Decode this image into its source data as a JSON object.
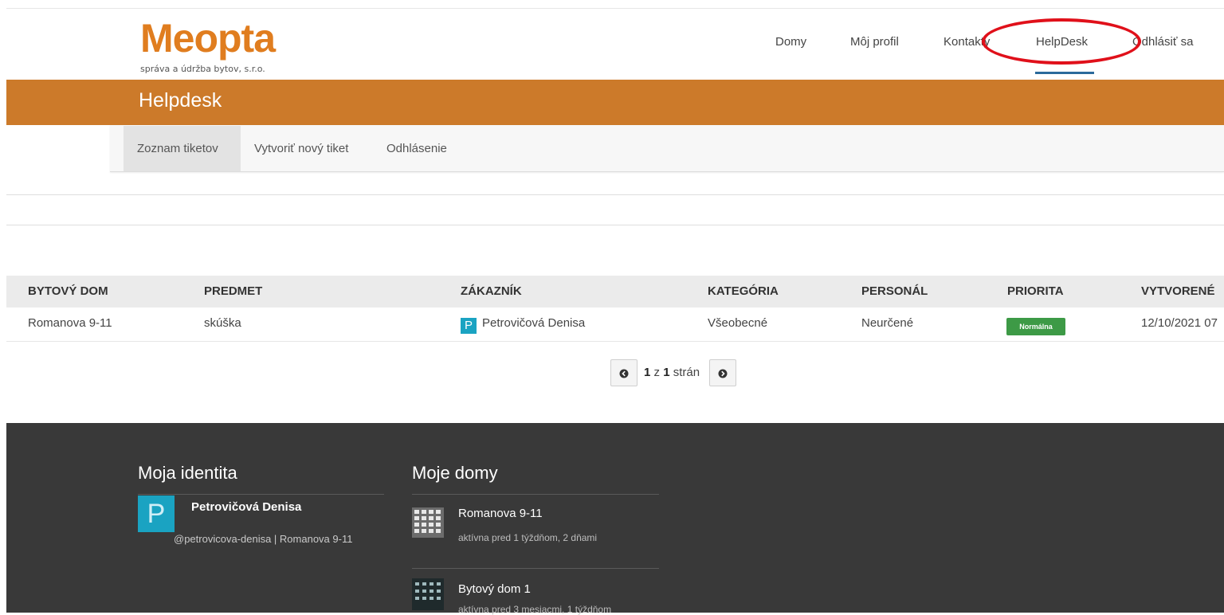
{
  "header": {
    "logo": "Meopta",
    "logo_sub": "správa a údržba bytov, s.r.o.",
    "nav": [
      "Domy",
      "Môj profil",
      "Kontakty",
      "HelpDesk",
      "Odhlásiť sa"
    ]
  },
  "page_title": "Helpdesk",
  "subnav": [
    "Zoznam tiketov",
    "Vytvoriť nový tiket",
    "Odhlásenie"
  ],
  "table": {
    "columns": [
      "BYTOVÝ DOM",
      "PREDMET",
      "ZÁKAZNÍK",
      "KATEGÓRIA",
      "PERSONÁL",
      "PRIORITA",
      "VYTVORENÉ"
    ],
    "rows": [
      {
        "house": "Romanova 9-11",
        "subject": "skúška",
        "customer_initial": "P",
        "customer": "Petrovičová Denisa",
        "category": "Všeobecné",
        "staff": "Neurčené",
        "priority": "Normálna",
        "created": "12/10/2021 07"
      }
    ]
  },
  "pagination": {
    "current": "1",
    "sep": "z",
    "total": "1",
    "suffix": "strán"
  },
  "footer": {
    "identity_title": "Moja identita",
    "identity_initial": "P",
    "identity_name": "Petrovičová Denisa",
    "identity_handle": "@petrovicova-denisa | Romanova 9-11",
    "houses_title": "Moje domy",
    "houses": [
      {
        "name": "Romanova 9-11",
        "activity": "aktívna pred 1 týždňom, 2 dňami"
      },
      {
        "name": "Bytový dom 1",
        "activity": "aktívna pred 3 mesiacmi, 1 týždňom"
      }
    ]
  },
  "colors": {
    "brand_orange": "#cc7a2a",
    "accent_blue": "#1aa3c2",
    "priority_green": "#3d9a46",
    "annotation_red": "#e0101a"
  }
}
